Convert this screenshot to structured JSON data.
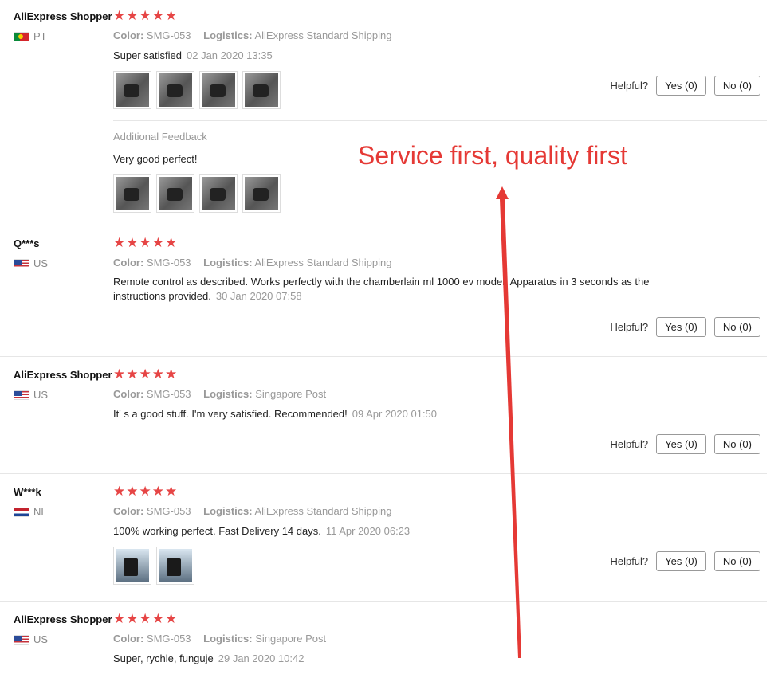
{
  "promo_text": "Service first, quality first",
  "helpful_label": "Helpful?",
  "reviews": [
    {
      "user": "AliExpress Shopper",
      "country": "PT",
      "stars": "★★★★★",
      "color_label": "Color:",
      "color_value": "SMG-053",
      "logistics_label": "Logistics:",
      "logistics_value": "AliExpress Standard Shipping",
      "text": "Super satisfied",
      "date": "02 Jan 2020 13:35",
      "yes": "Yes (0)",
      "no": "No (0)",
      "additional_label": "Additional Feedback",
      "additional_text": "Very good perfect!"
    },
    {
      "user": "Q***s",
      "country": "US",
      "stars": "★★★★★",
      "color_label": "Color:",
      "color_value": "SMG-053",
      "logistics_label": "Logistics:",
      "logistics_value": "AliExpress Standard Shipping",
      "text_line1": "Remote control as described. Works perfectly with the chamberlain ml 1000 ev model. Apparatus in 3 seconds as the",
      "text_line2": "instructions provided.",
      "date": "30 Jan 2020 07:58",
      "yes": "Yes (0)",
      "no": "No (0)"
    },
    {
      "user": "AliExpress Shopper",
      "country": "US",
      "stars": "★★★★★",
      "color_label": "Color:",
      "color_value": "SMG-053",
      "logistics_label": "Logistics:",
      "logistics_value": "Singapore Post",
      "text": "It' s a good stuff. I'm very satisfied. Recommended!",
      "date": "09 Apr 2020 01:50",
      "yes": "Yes (0)",
      "no": "No (0)"
    },
    {
      "user": "W***k",
      "country": "NL",
      "stars": "★★★★★",
      "color_label": "Color:",
      "color_value": "SMG-053",
      "logistics_label": "Logistics:",
      "logistics_value": "AliExpress Standard Shipping",
      "text": "100% working perfect. Fast Delivery 14 days.",
      "date": "11 Apr 2020 06:23",
      "yes": "Yes (0)",
      "no": "No (0)"
    },
    {
      "user": "AliExpress Shopper",
      "country": "US",
      "stars": "★★★★★",
      "color_label": "Color:",
      "color_value": "SMG-053",
      "logistics_label": "Logistics:",
      "logistics_value": "Singapore Post",
      "text": "Super, rychle, funguje",
      "date": "29 Jan 2020 10:42"
    }
  ]
}
